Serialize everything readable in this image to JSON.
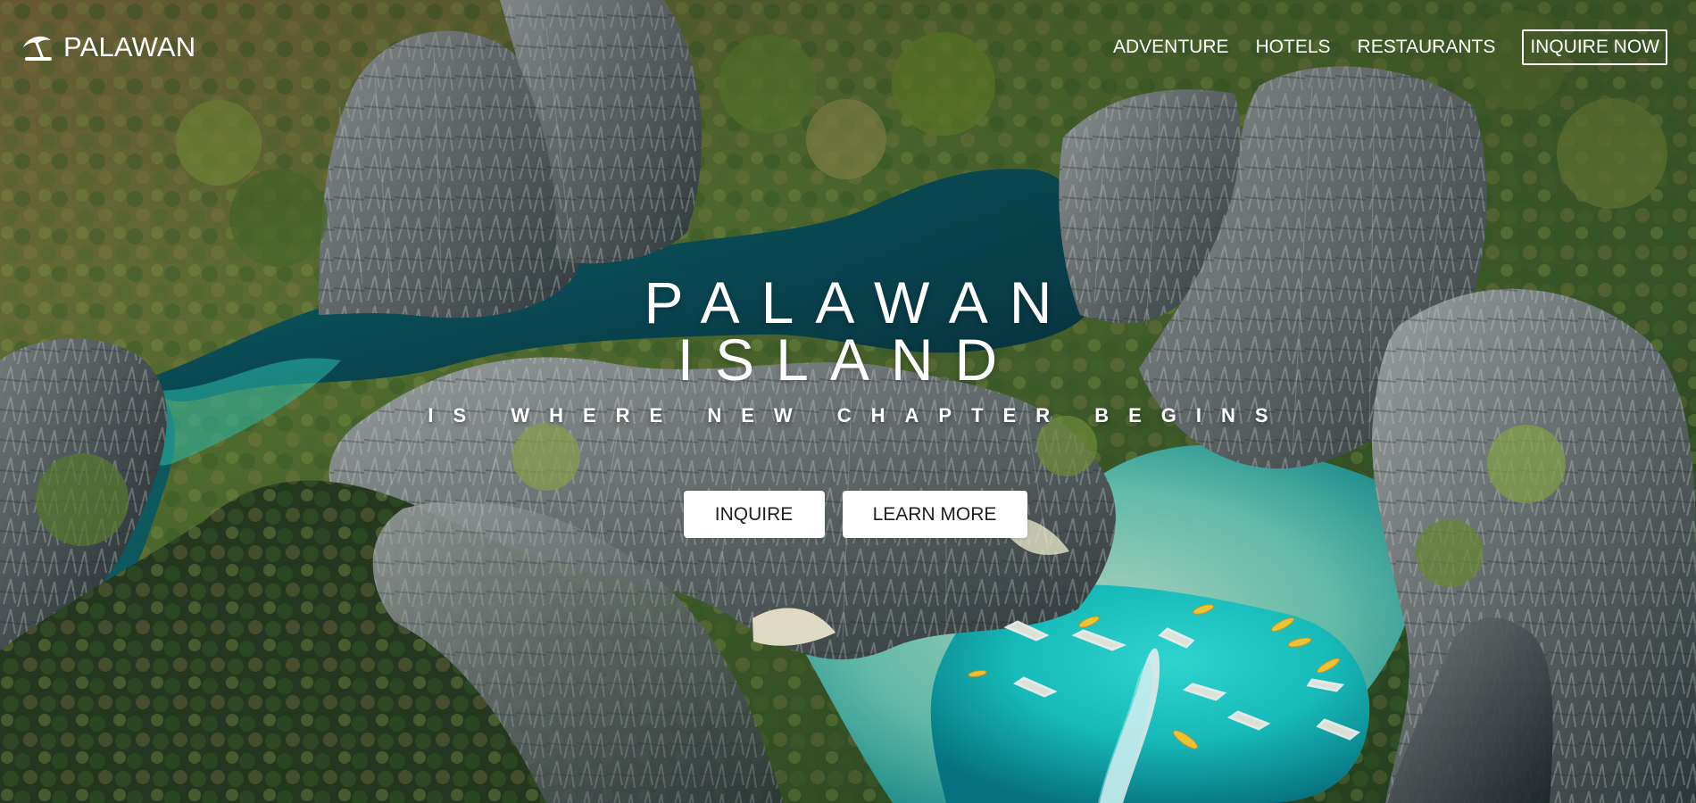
{
  "brand": {
    "name": "PALAWAN",
    "icon": "umbrella-icon"
  },
  "navigation": {
    "items": [
      {
        "label": "ADVENTURE"
      },
      {
        "label": "HOTELS"
      },
      {
        "label": "RESTAURANTS"
      },
      {
        "label": "INQUIRE NOW"
      }
    ]
  },
  "hero": {
    "title_line_1": "PALAWAN",
    "title_line_2": "ISLAND",
    "subtitle": "IS WHERE NEW CHAPTER BEGINS",
    "buttons": {
      "inquire": "INQUIRE",
      "learn_more": "LEARN MORE"
    }
  },
  "colors": {
    "text": "#ffffff",
    "button_background": "#ffffff",
    "button_text": "#1f1f1f",
    "lagoon_dark": "#0f5d63",
    "lagoon_bright": "#19d1d0",
    "rock": "#767b7c",
    "foliage": "#607b35"
  }
}
